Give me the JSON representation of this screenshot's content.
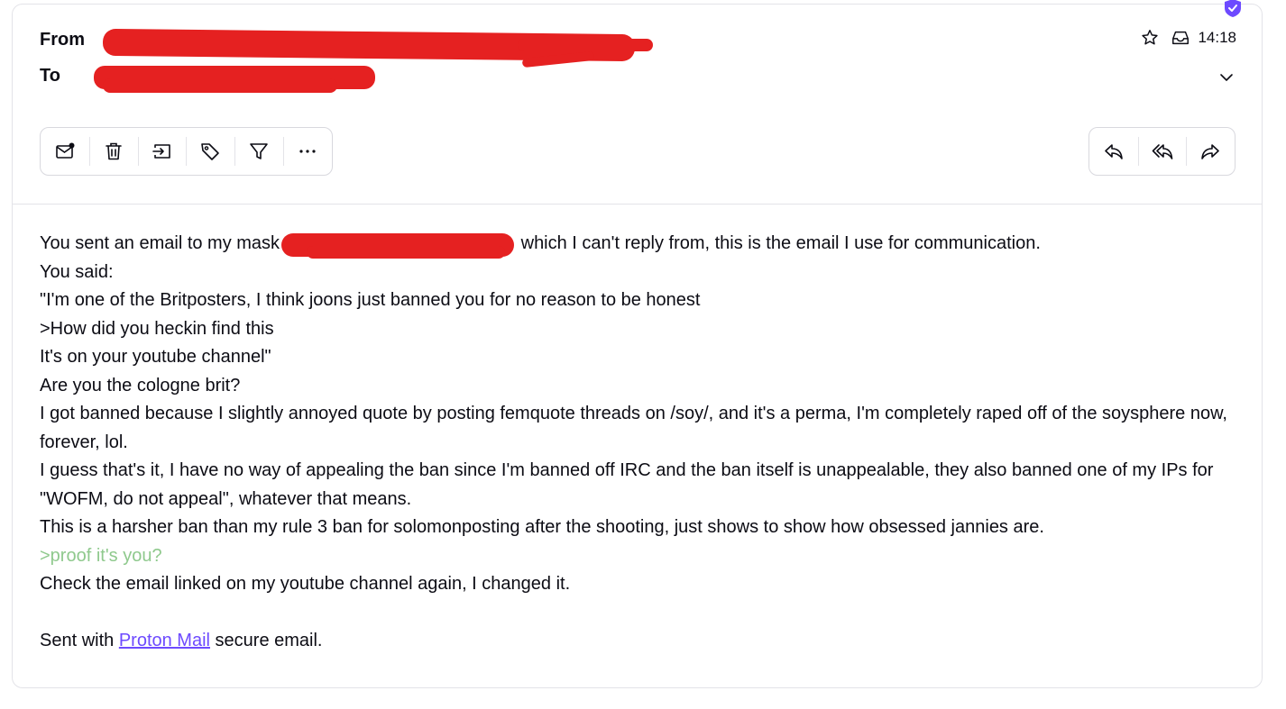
{
  "header": {
    "from_label": "From",
    "to_label": "To",
    "time": "14:18",
    "icons": {
      "verified": "shield-check-icon",
      "star": "star-icon",
      "folder": "inbox-tray-icon",
      "expand": "chevron-down-icon"
    }
  },
  "toolbar": {
    "left": [
      {
        "name": "mark-unread-button",
        "icon": "envelope-dot-icon"
      },
      {
        "name": "trash-button",
        "icon": "trash-icon"
      },
      {
        "name": "move-button",
        "icon": "move-to-folder-icon"
      },
      {
        "name": "label-button",
        "icon": "tag-icon"
      },
      {
        "name": "filter-button",
        "icon": "filter-icon"
      },
      {
        "name": "more-button",
        "icon": "ellipsis-icon"
      }
    ],
    "right": [
      {
        "name": "reply-button",
        "icon": "reply-icon"
      },
      {
        "name": "reply-all-button",
        "icon": "reply-all-icon"
      },
      {
        "name": "forward-button",
        "icon": "forward-icon"
      }
    ]
  },
  "message": {
    "line1_before": "You sent an email to my mask",
    "line1_after": " which I can't reply from, this is the email I use for communication.",
    "lines": [
      "You said:",
      "\"I'm one of the Britposters, I think joons just banned you for no reason to be honest",
      ">How did you heckin find this",
      "It's on your youtube channel\"",
      "Are you the cologne brit?",
      "I got banned because I slightly annoyed quote by posting femquote threads on /soy/, and it's a perma, I'm completely raped off of the soysphere now, forever, lol.",
      "I guess that's it, I have no way of appealing the ban since I'm banned off IRC and the ban itself is unappealable, they also banned one of my IPs for \"WOFM, do not appeal\", whatever that means.",
      "This is a harsher ban than my rule 3 ban for solomonposting after the shooting, just shows to show how obsessed jannies are."
    ],
    "quote_line": ">proof it's you?",
    "after_quote": "Check the email linked on my youtube channel again, I changed it.",
    "signature_before": "Sent with ",
    "signature_link": "Proton Mail",
    "signature_after": " secure email."
  },
  "colors": {
    "redaction": "#e52121",
    "greentext": "#8fc98d",
    "link": "#6d4aff",
    "brand": "#6d4aff"
  }
}
